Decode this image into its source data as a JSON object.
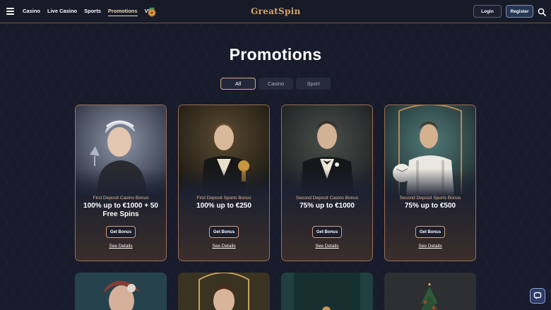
{
  "header": {
    "nav": [
      "Casino",
      "Live Casino",
      "Sports",
      "Promotions",
      "VIP"
    ],
    "active_nav": "Promotions",
    "logo": "GreatSpin",
    "login_label": "Login",
    "register_label": "Register"
  },
  "page": {
    "title": "Promotions",
    "filters": [
      "All",
      "Casino",
      "Sport"
    ],
    "active_filter": "All"
  },
  "cards": [
    {
      "category": "First Deposit Casino Bonus",
      "offer": "100% up to €1000 + 50 Free Spins",
      "button": "Get Bonus",
      "link": "See Details"
    },
    {
      "category": "First Deposit Sports Bonus",
      "offer": "100% up to €250",
      "button": "Get Bonus",
      "link": "See Details"
    },
    {
      "category": "Second Deposit Casino Bonus",
      "offer": "75% up to €1000",
      "button": "Get Bonus",
      "link": "See Details"
    },
    {
      "category": "Second Deposit Sports Bonus",
      "offer": "75% up to €500",
      "button": "Get Bonus",
      "link": "See Details"
    }
  ],
  "colors": {
    "background": "#171b2b",
    "accent": "#d8a57e",
    "card_border": "#9a6e53",
    "category_text": "#e8b98e"
  },
  "icons": [
    "menu-icon",
    "vip-crown-icon",
    "search-icon",
    "chat-icon"
  ]
}
